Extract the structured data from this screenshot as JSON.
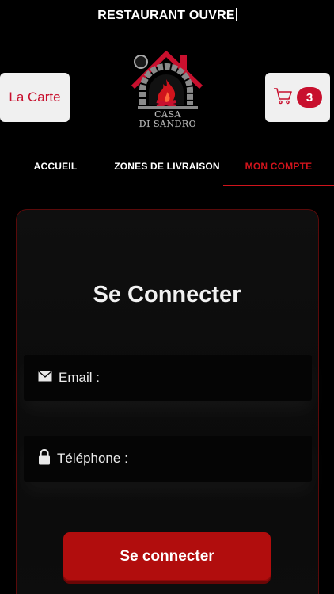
{
  "header": {
    "status": "RESTAURANT OUVRE",
    "menu_button": "La Carte",
    "cart_count": "3",
    "logo_line1": "CASA",
    "logo_line2": "DI SANDRO"
  },
  "nav": {
    "tabs": [
      {
        "label": "ACCUEIL",
        "active": false
      },
      {
        "label": "ZONES DE LIVRAISON",
        "active": false
      },
      {
        "label": "MON COMPTE",
        "active": true
      }
    ]
  },
  "login": {
    "title": "Se Connecter",
    "email_label": "Email :",
    "phone_label": "Téléphone :",
    "submit_label": "Se connecter"
  },
  "colors": {
    "accent": "#c8102e",
    "background": "#000000",
    "button": "#b10d0d"
  },
  "icons": {
    "cart": "cart-icon",
    "email": "envelope-icon",
    "phone": "lock-icon",
    "logo": "oven-flame-logo"
  }
}
